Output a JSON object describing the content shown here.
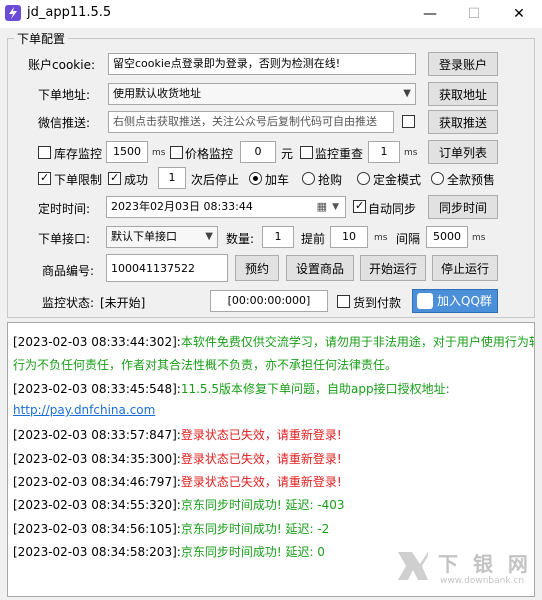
{
  "window": {
    "title": "jd_app11.5.5",
    "minimize": "—",
    "maximize": "☐",
    "close": "✕"
  },
  "group": {
    "title": "下单配置"
  },
  "cookie": {
    "label": "账户cookie:",
    "value": "留空cookie点登录即为登录，否则为检测在线!",
    "button": "登录账户"
  },
  "address": {
    "label": "下单地址:",
    "value": "使用默认收货地址",
    "button": "获取地址"
  },
  "wechat": {
    "label": "微信推送:",
    "value": "右侧点击获取推送，关注公众号后复制代码可自由推送",
    "button": "获取推送"
  },
  "row4": {
    "stock_label": "库存监控",
    "stock_value": "1500",
    "stock_unit": "ms",
    "price_label": "价格监控",
    "price_value": "0",
    "price_unit": "元",
    "recheck_label": "监控重查",
    "recheck_value": "1",
    "recheck_unit": "ms",
    "button": "订单列表"
  },
  "row5": {
    "limit_label": "下单限制",
    "success_label": "成功",
    "success_value": "1",
    "stop_label": "次后停止",
    "radios": [
      "加车",
      "抢购",
      "定金模式",
      "全款预售"
    ]
  },
  "timer": {
    "label": "定时时间:",
    "value": "2023年02月03日  08:33:44",
    "auto_sync": "自动同步",
    "button": "同步时间"
  },
  "api": {
    "label": "下单接口:",
    "value": "默认下单接口",
    "qty_label": "数量:",
    "qty_value": "1",
    "advance_label": "提前",
    "advance_value": "10",
    "advance_unit": "ms",
    "interval_label": "间隔",
    "interval_value": "5000",
    "interval_unit": "ms"
  },
  "product": {
    "label": "商品编号:",
    "value": "100041137522",
    "btn_reserve": "预约",
    "btn_set": "设置商品",
    "btn_start": "开始运行",
    "btn_stop": "停止运行"
  },
  "status": {
    "label": "监控状态:",
    "value": "[未开始]",
    "timer": "[00:00:00:000]",
    "pay_label": "货到付款",
    "qq_button": "加入QQ群"
  },
  "log": [
    {
      "ts": "[2023-02-03 08:33:44:302]:",
      "msg": "本软件免费仅供交流学习，请勿用于非法用途，对于用户使用行为软件",
      "color": "green"
    },
    {
      "ts": "",
      "msg": "行为不负任何责任，作者对其合法性概不负责，亦不承担任何法律责任。",
      "color": "green"
    },
    {
      "ts": "[2023-02-03 08:33:45:548]:",
      "msg": "11.5.5版本修复下单问题，自助app接口授权地址:",
      "color": "green"
    },
    {
      "ts": "",
      "msg": "http://pay.dnfchina.com",
      "color": "link"
    },
    {
      "ts": "[2023-02-03 08:33:57:847]:",
      "msg": "登录状态已失效，请重新登录!",
      "color": "red"
    },
    {
      "ts": "[2023-02-03 08:34:35:300]:",
      "msg": "登录状态已失效，请重新登录!",
      "color": "red"
    },
    {
      "ts": "[2023-02-03 08:34:46:797]:",
      "msg": "登录状态已失效，请重新登录!",
      "color": "red"
    },
    {
      "ts": "[2023-02-03 08:34:55:320]:",
      "msg": "京东同步时间成功! 延迟: -403",
      "color": "green"
    },
    {
      "ts": "[2023-02-03 08:34:56:105]:",
      "msg": "京东同步时间成功! 延迟: -2",
      "color": "green"
    },
    {
      "ts": "[2023-02-03 08:34:58:203]:",
      "msg": "京东同步时间成功! 延迟: 0",
      "color": "green"
    }
  ],
  "watermark": {
    "brand": "下 银 网",
    "url": "www.downbank.cn"
  }
}
